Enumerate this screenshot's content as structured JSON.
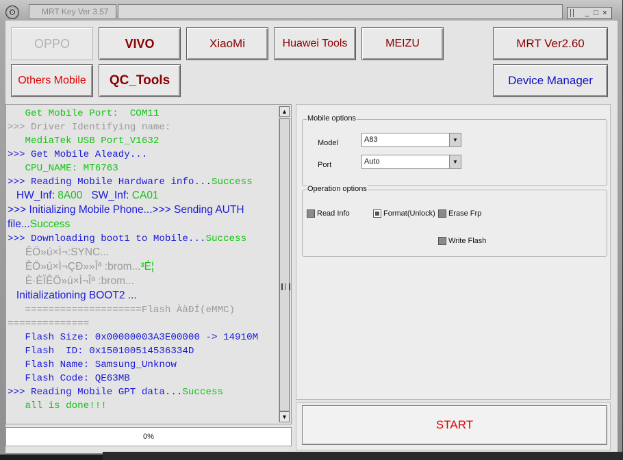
{
  "window": {
    "title": "MRT Key Ver 3.57",
    "controls": [
      "_",
      "□",
      "×"
    ]
  },
  "brands": {
    "oppo": "OPPO",
    "vivo": "VIVO",
    "xiaomi": "XiaoMi",
    "huawei": "Huawei Tools",
    "meizu": "MEIZU",
    "mrt": "MRT Ver2.60",
    "others": "Others Mobile",
    "qc": "QC_Tools",
    "device_manager": "Device Manager"
  },
  "log": [
    {
      "parts": [
        {
          "t": "   Get Mobile Port:  COM11",
          "c": "green"
        }
      ]
    },
    {
      "parts": [
        {
          "t": ">>> Driver Identifying name:",
          "c": "gray"
        }
      ]
    },
    {
      "parts": [
        {
          "t": "   MediaTek USB Port_V1632",
          "c": "green"
        }
      ]
    },
    {
      "parts": [
        {
          "t": ">>> Get Mobile Aleady...",
          "c": "blue"
        }
      ]
    },
    {
      "parts": [
        {
          "t": "   CPU_NAME: MT6763",
          "c": "green"
        }
      ]
    },
    {
      "parts": [
        {
          "t": ">>> Reading Mobile Hardware info...",
          "c": "blue"
        },
        {
          "t": "Success",
          "c": "green"
        }
      ]
    },
    {
      "parts": [
        {
          "t": "   HW_Inf: ",
          "c": "blue",
          "s": 1
        },
        {
          "t": "8A00",
          "c": "green",
          "s": 1
        },
        {
          "t": "   SW_Inf: ",
          "c": "blue",
          "s": 1
        },
        {
          "t": "CA01",
          "c": "green",
          "s": 1
        }
      ]
    },
    {
      "parts": [
        {
          "t": ">>> Initializing Mobile Phone...>>> Sending AUTH",
          "c": "blue",
          "s": 1
        }
      ]
    },
    {
      "parts": [
        {
          "t": "file...",
          "c": "blue",
          "s": 1
        },
        {
          "t": "Success",
          "c": "green",
          "s": 1
        }
      ]
    },
    {
      "parts": [
        {
          "t": ">>> Downloading boot1 to Mobile...",
          "c": "blue"
        },
        {
          "t": "Success",
          "c": "green"
        }
      ]
    },
    {
      "parts": [
        {
          "t": "      ÊÖ»ú×Ì¬:SYNC...",
          "c": "gray",
          "s": 1
        }
      ]
    },
    {
      "parts": [
        {
          "t": "      ÊÖ»ú×Ì¬ÇĐ»»Îª :brom...",
          "c": "gray",
          "s": 1
        },
        {
          "t": "³É¦",
          "c": "green",
          "s": 1
        }
      ]
    },
    {
      "parts": [
        {
          "t": "      È·ÈÏÊÖ»ú×Ì¬Îª :brom...",
          "c": "gray",
          "s": 1
        }
      ]
    },
    {
      "parts": [
        {
          "t": "   Initializationing BOOT2 ...",
          "c": "blue",
          "s": 1
        }
      ]
    },
    {
      "parts": [
        {
          "t": "   ====================Flash ÀàĐÍ(eMMC)",
          "c": "gray"
        }
      ]
    },
    {
      "parts": [
        {
          "t": "==============",
          "c": "gray"
        }
      ]
    },
    {
      "parts": [
        {
          "t": "   Flash Size: 0x00000003A3E00000 -> 14910M",
          "c": "blue"
        }
      ]
    },
    {
      "parts": [
        {
          "t": "   Flash  ID: 0x150100514536334D",
          "c": "blue"
        }
      ]
    },
    {
      "parts": [
        {
          "t": "   Flash Name: Samsung_Unknow",
          "c": "blue"
        }
      ]
    },
    {
      "parts": [
        {
          "t": "   Flash Code: QE63MB",
          "c": "blue"
        }
      ]
    },
    {
      "parts": [
        {
          "t": ">>> Reading Mobile GPT data...",
          "c": "blue"
        },
        {
          "t": "Success",
          "c": "green"
        }
      ]
    },
    {
      "parts": [
        {
          "t": "   all is done!!!",
          "c": "green"
        }
      ]
    }
  ],
  "progress": {
    "value": 0,
    "label": "0%"
  },
  "mobile_options": {
    "title": "Mobile options",
    "model_label": "Model",
    "model_value": "A83",
    "port_label": "Port",
    "port_value": "Auto"
  },
  "operation_options": {
    "title": "Operation options",
    "read_info": "Read Info",
    "format_unlock": "Format(Unlock)",
    "erase_frp": "Erase Frp",
    "write_flash": "Write Flash"
  },
  "start_label": "START",
  "colors": {
    "blue": "#1a1ad8",
    "green": "#12c412",
    "gray": "#9a9a9a",
    "dark_red": "#8b0000",
    "red": "#e00000"
  }
}
